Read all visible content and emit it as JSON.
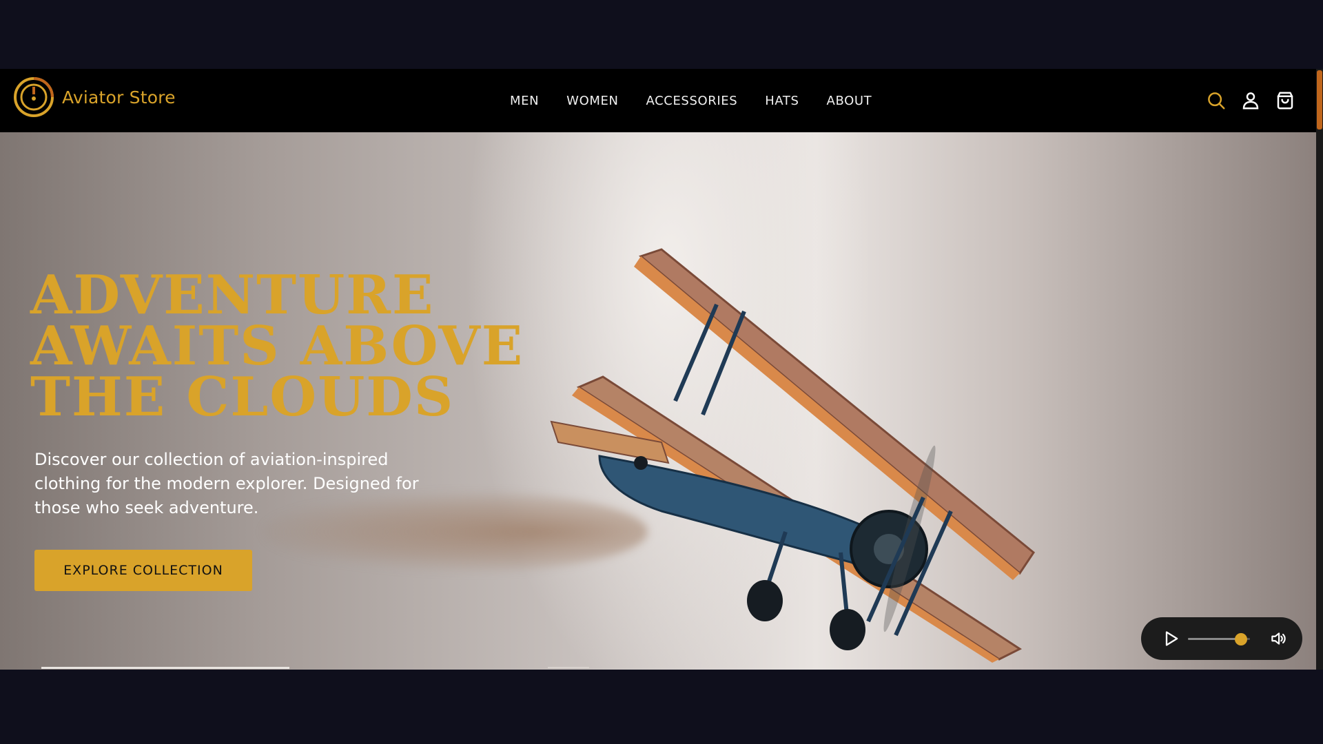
{
  "brand": {
    "name": "Aviator Store",
    "accent": "#d9a32a"
  },
  "nav": {
    "items": [
      {
        "label": "MEN"
      },
      {
        "label": "WOMEN"
      },
      {
        "label": "ACCESSORIES"
      },
      {
        "label": "HATS"
      },
      {
        "label": "ABOUT"
      }
    ]
  },
  "header_actions": {
    "icons": [
      "search-icon",
      "account-icon",
      "cart-icon"
    ]
  },
  "hero": {
    "title": "Adventure Awaits Above The Clouds",
    "description": "Discover our collection of aviation-inspired clothing for the modern explorer. Designed for those who seek adventure.",
    "cta_label": "EXPLORE COLLECTION"
  },
  "player": {
    "volume_fraction": 0.85,
    "icons": [
      "play-icon",
      "volume-icon"
    ]
  },
  "colors": {
    "accent": "#d9a32a",
    "scroll_thumb": "#c0661c",
    "page_background": "#0f0f1c"
  }
}
